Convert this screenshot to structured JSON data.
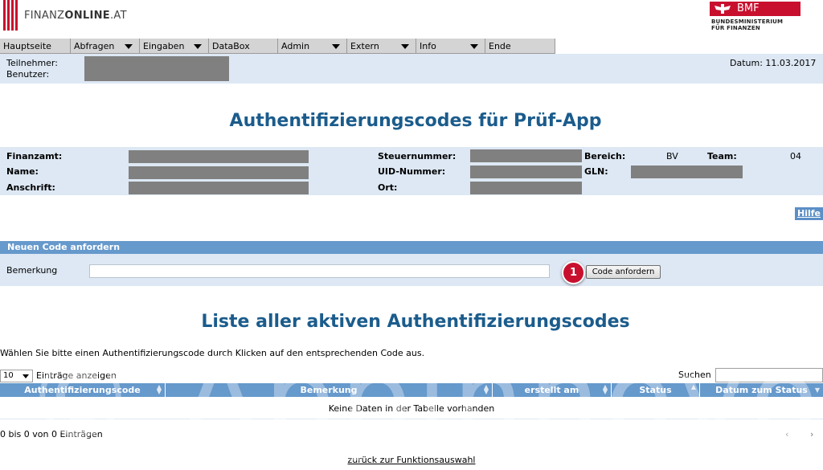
{
  "header": {
    "logo_prefix": "FINANZ",
    "logo_bold": "ONLINE",
    "logo_suffix": ".AT",
    "bmf_label": "BMF",
    "bmf_sub_line1": "BUNDESMINISTERIUM",
    "bmf_sub_line2": "FÜR FINANZEN"
  },
  "menu": [
    {
      "label": "Hauptseite",
      "dropdown": false
    },
    {
      "label": "Abfragen",
      "dropdown": true
    },
    {
      "label": "Eingaben",
      "dropdown": true
    },
    {
      "label": "DataBox",
      "dropdown": false
    },
    {
      "label": "Admin",
      "dropdown": true
    },
    {
      "label": "Extern",
      "dropdown": true
    },
    {
      "label": "Info",
      "dropdown": true
    },
    {
      "label": "Ende",
      "dropdown": false
    }
  ],
  "userinfo": {
    "teilnehmer_label": "Teilnehmer:",
    "benutzer_label": "Benutzer:",
    "date_label": "Datum:",
    "date_value": "11.03.2017"
  },
  "page_title": "Authentifizierungscodes für Prüf-App",
  "details": {
    "finanzamt_label": "Finanzamt:",
    "name_label": "Name:",
    "anschrift_label": "Anschrift:",
    "steuernummer_label": "Steuernummer:",
    "uid_label": "UID-Nummer:",
    "ort_label": "Ort:",
    "bereich_label": "Bereich:",
    "bereich_value": "BV",
    "team_label": "Team:",
    "team_value": "04",
    "gln_label": "GLN:"
  },
  "help_label": "Hilfe",
  "new_code": {
    "section_title": "Neuen Code anfordern",
    "bemerkung_label": "Bemerkung",
    "bemerkung_value": "",
    "badge": "1",
    "button_label": "Code anfordern"
  },
  "list_title": "Liste aller aktiven Authentifizierungscodes",
  "instruction": "Wählen Sie bitte einen Authentifizierungscode durch Klicken auf den entsprechenden Code aus.",
  "table_controls": {
    "length_value": "10",
    "length_label": "Einträge anzeigen",
    "search_label": "Suchen",
    "search_value": ""
  },
  "table": {
    "columns": [
      "Authentifizierungscode",
      "Bemerkung",
      "erstellt am",
      "Status",
      "Datum zum Status"
    ],
    "empty_text": "Keine Daten in der Tabelle vorhanden",
    "info_text": "0 bis 0 von 0 Einträgen",
    "prev": "‹",
    "next": "›"
  },
  "back_link": "zurück zur Funktionsauswahl",
  "watermark": "© Appinnovo",
  "colors": {
    "brand_red": "#c8102e",
    "title_blue": "#1b5c8c",
    "section_blue": "#6699cc",
    "light_blue": "#dde8f4"
  }
}
